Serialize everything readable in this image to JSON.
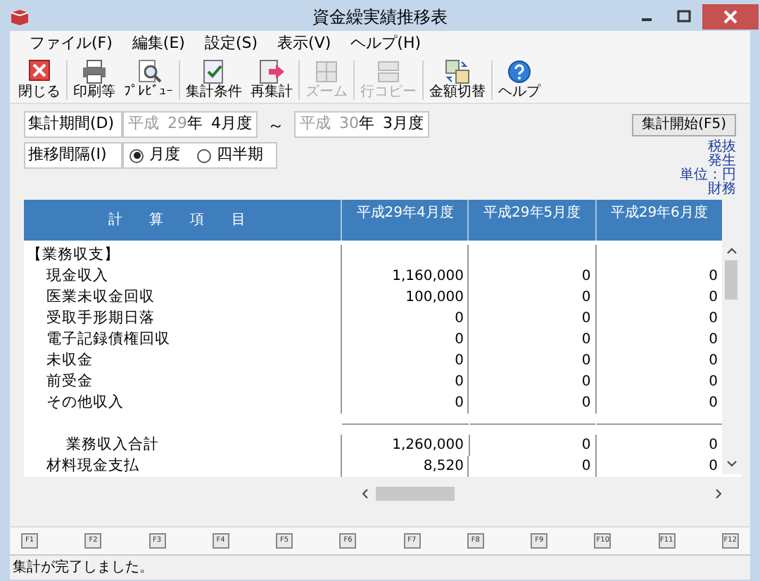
{
  "window": {
    "title": "資金繰実績推移表"
  },
  "menu": [
    {
      "label": "ファイル(F)"
    },
    {
      "label": "編集(E)"
    },
    {
      "label": "設定(S)"
    },
    {
      "label": "表示(V)"
    },
    {
      "label": "ヘルプ(H)"
    }
  ],
  "toolbar": [
    {
      "label": "閉じる",
      "kind": "close",
      "disabled": false
    },
    {
      "label": "印刷等",
      "kind": "print",
      "disabled": false
    },
    {
      "label": "ﾌﾟﾚﾋﾞｭｰ",
      "kind": "preview",
      "disabled": false
    },
    {
      "label": "集計条件",
      "kind": "conditions",
      "disabled": false
    },
    {
      "label": "再集計",
      "kind": "recalc",
      "disabled": false
    },
    {
      "label": "ズーム",
      "kind": "zoom",
      "disabled": true
    },
    {
      "label": "行コピー",
      "kind": "copy",
      "disabled": true
    },
    {
      "label": "金額切替",
      "kind": "switch",
      "disabled": false
    },
    {
      "label": "ヘルプ",
      "kind": "help",
      "disabled": false
    }
  ],
  "period": {
    "label": "集計期間(D)",
    "from": {
      "era": "平成",
      "year": "29",
      "year_unit": "年",
      "month": "4月度"
    },
    "separator": "～",
    "to": {
      "era": "平成",
      "year": "30",
      "year_unit": "年",
      "month": "3月度"
    }
  },
  "interval": {
    "label": "推移間隔(I)",
    "options": [
      {
        "label": "月度",
        "selected": true
      },
      {
        "label": "四半期",
        "selected": false
      }
    ]
  },
  "start_button": "集計開始(F5)",
  "notes": [
    "税抜",
    "発生",
    "単位：円",
    "財務"
  ],
  "table": {
    "columns": [
      "計 算 項 目",
      "平成29年4月度",
      "平成29年5月度",
      "平成29年6月度"
    ],
    "rows": [
      {
        "kind": "heading",
        "label": "【業務収支】",
        "values": []
      },
      {
        "kind": "item",
        "label": "現金収入",
        "values": [
          "1,160,000",
          "0",
          "0"
        ]
      },
      {
        "kind": "item",
        "label": "医業未収金回収",
        "values": [
          "100,000",
          "0",
          "0"
        ]
      },
      {
        "kind": "item",
        "label": "受取手形期日落",
        "values": [
          "0",
          "0",
          "0"
        ]
      },
      {
        "kind": "item",
        "label": "電子記録債権回収",
        "values": [
          "0",
          "0",
          "0"
        ]
      },
      {
        "kind": "item",
        "label": "未収金",
        "values": [
          "0",
          "0",
          "0"
        ]
      },
      {
        "kind": "item",
        "label": "前受金",
        "values": [
          "0",
          "0",
          "0"
        ]
      },
      {
        "kind": "item",
        "label": "その他収入",
        "values": [
          "0",
          "0",
          "0"
        ]
      },
      {
        "kind": "total",
        "label": "業務収入合計",
        "values": [
          "1,260,000",
          "0",
          "0"
        ]
      },
      {
        "kind": "item",
        "label": "材料現金支払",
        "values": [
          "8,520",
          "0",
          "0"
        ]
      }
    ]
  },
  "function_keys": [
    "F1",
    "F2",
    "F3",
    "F4",
    "F5",
    "F6",
    "F7",
    "F8",
    "F9",
    "F10",
    "F11",
    "F12"
  ],
  "status_bar": "集計が完了しました。"
}
